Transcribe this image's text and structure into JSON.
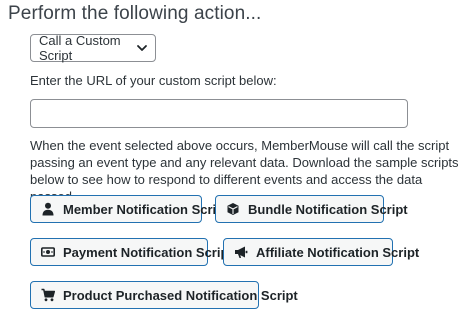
{
  "heading": "Perform the following action...",
  "action_select": {
    "selected": "Call a Custom Script",
    "icon": "chevron-down-icon"
  },
  "url_field": {
    "label": "Enter the URL of your custom script below:",
    "value": "",
    "placeholder": ""
  },
  "description": "When the event selected above occurs, MemberMouse will call the script passing an event type and any relevant data. Download the sample scripts below to see how to respond to different events and access the data passed.",
  "buttons": [
    {
      "label": "Member Notification Script",
      "icon": "user-icon"
    },
    {
      "label": "Bundle Notification Script",
      "icon": "cube-icon"
    },
    {
      "label": "Payment Notification Script",
      "icon": "money-bill-icon"
    },
    {
      "label": "Affiliate Notification Script",
      "icon": "bullhorn-icon"
    },
    {
      "label": "Product Purchased Notification Script",
      "icon": "shopping-cart-icon"
    }
  ],
  "colors": {
    "button_border": "#2271b1",
    "button_background": "#f6f7f7",
    "text": "#1d2327"
  }
}
